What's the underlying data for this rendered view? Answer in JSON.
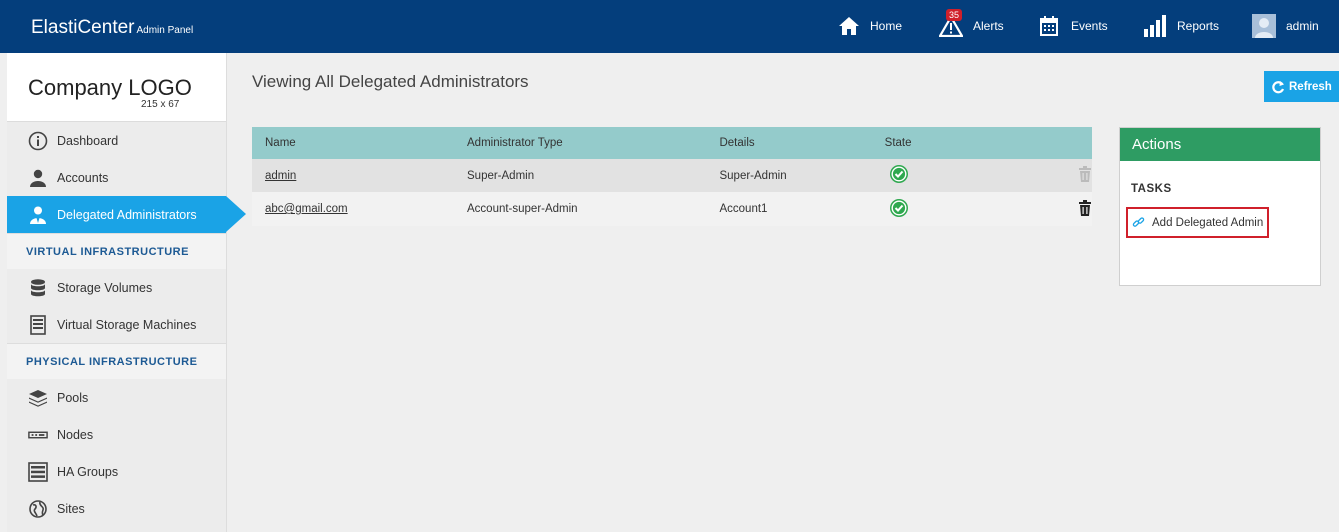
{
  "header": {
    "brand": "ElastiCenter",
    "brand_sub": "Admin Panel",
    "nav": {
      "home": "Home",
      "alerts": "Alerts",
      "alerts_badge": "35",
      "events": "Events",
      "reports": "Reports",
      "user": "admin"
    }
  },
  "sidebar": {
    "logo_text": "Company LOGO",
    "logo_size": "215 x 67",
    "items": {
      "dashboard": "Dashboard",
      "accounts": "Accounts",
      "delegated": "Delegated Administrators",
      "virtual_section": "VIRTUAL INFRASTRUCTURE",
      "storage_volumes": "Storage Volumes",
      "vsm": "Virtual Storage Machines",
      "physical_section": "PHYSICAL INFRASTRUCTURE",
      "pools": "Pools",
      "nodes": "Nodes",
      "ha_groups": "HA Groups",
      "sites": "Sites"
    },
    "active_item": "Delegated Administrators"
  },
  "main": {
    "title": "Viewing All Delegated Administrators",
    "refresh_label": "Refresh",
    "table": {
      "columns": {
        "name": "Name",
        "type": "Administrator Type",
        "details": "Details",
        "state": "State"
      },
      "rows": [
        {
          "name": "admin",
          "type": "Super-Admin",
          "details": "Super-Admin",
          "state": "ok",
          "delete_enabled": false
        },
        {
          "name": "abc@gmail.com",
          "type": "Account-super-Admin",
          "details": "Account1",
          "state": "ok",
          "delete_enabled": true
        }
      ]
    }
  },
  "actions": {
    "title": "Actions",
    "tasks_label": "TASKS",
    "add_label": "Add Delegated Admin"
  },
  "colors": {
    "topbar": "#043e7c",
    "accent": "#1aa3e6",
    "table_header": "#94cbcb",
    "actions_header": "#2e9c63",
    "highlight_border": "#d0202b",
    "state_ok": "#2fa84f"
  }
}
